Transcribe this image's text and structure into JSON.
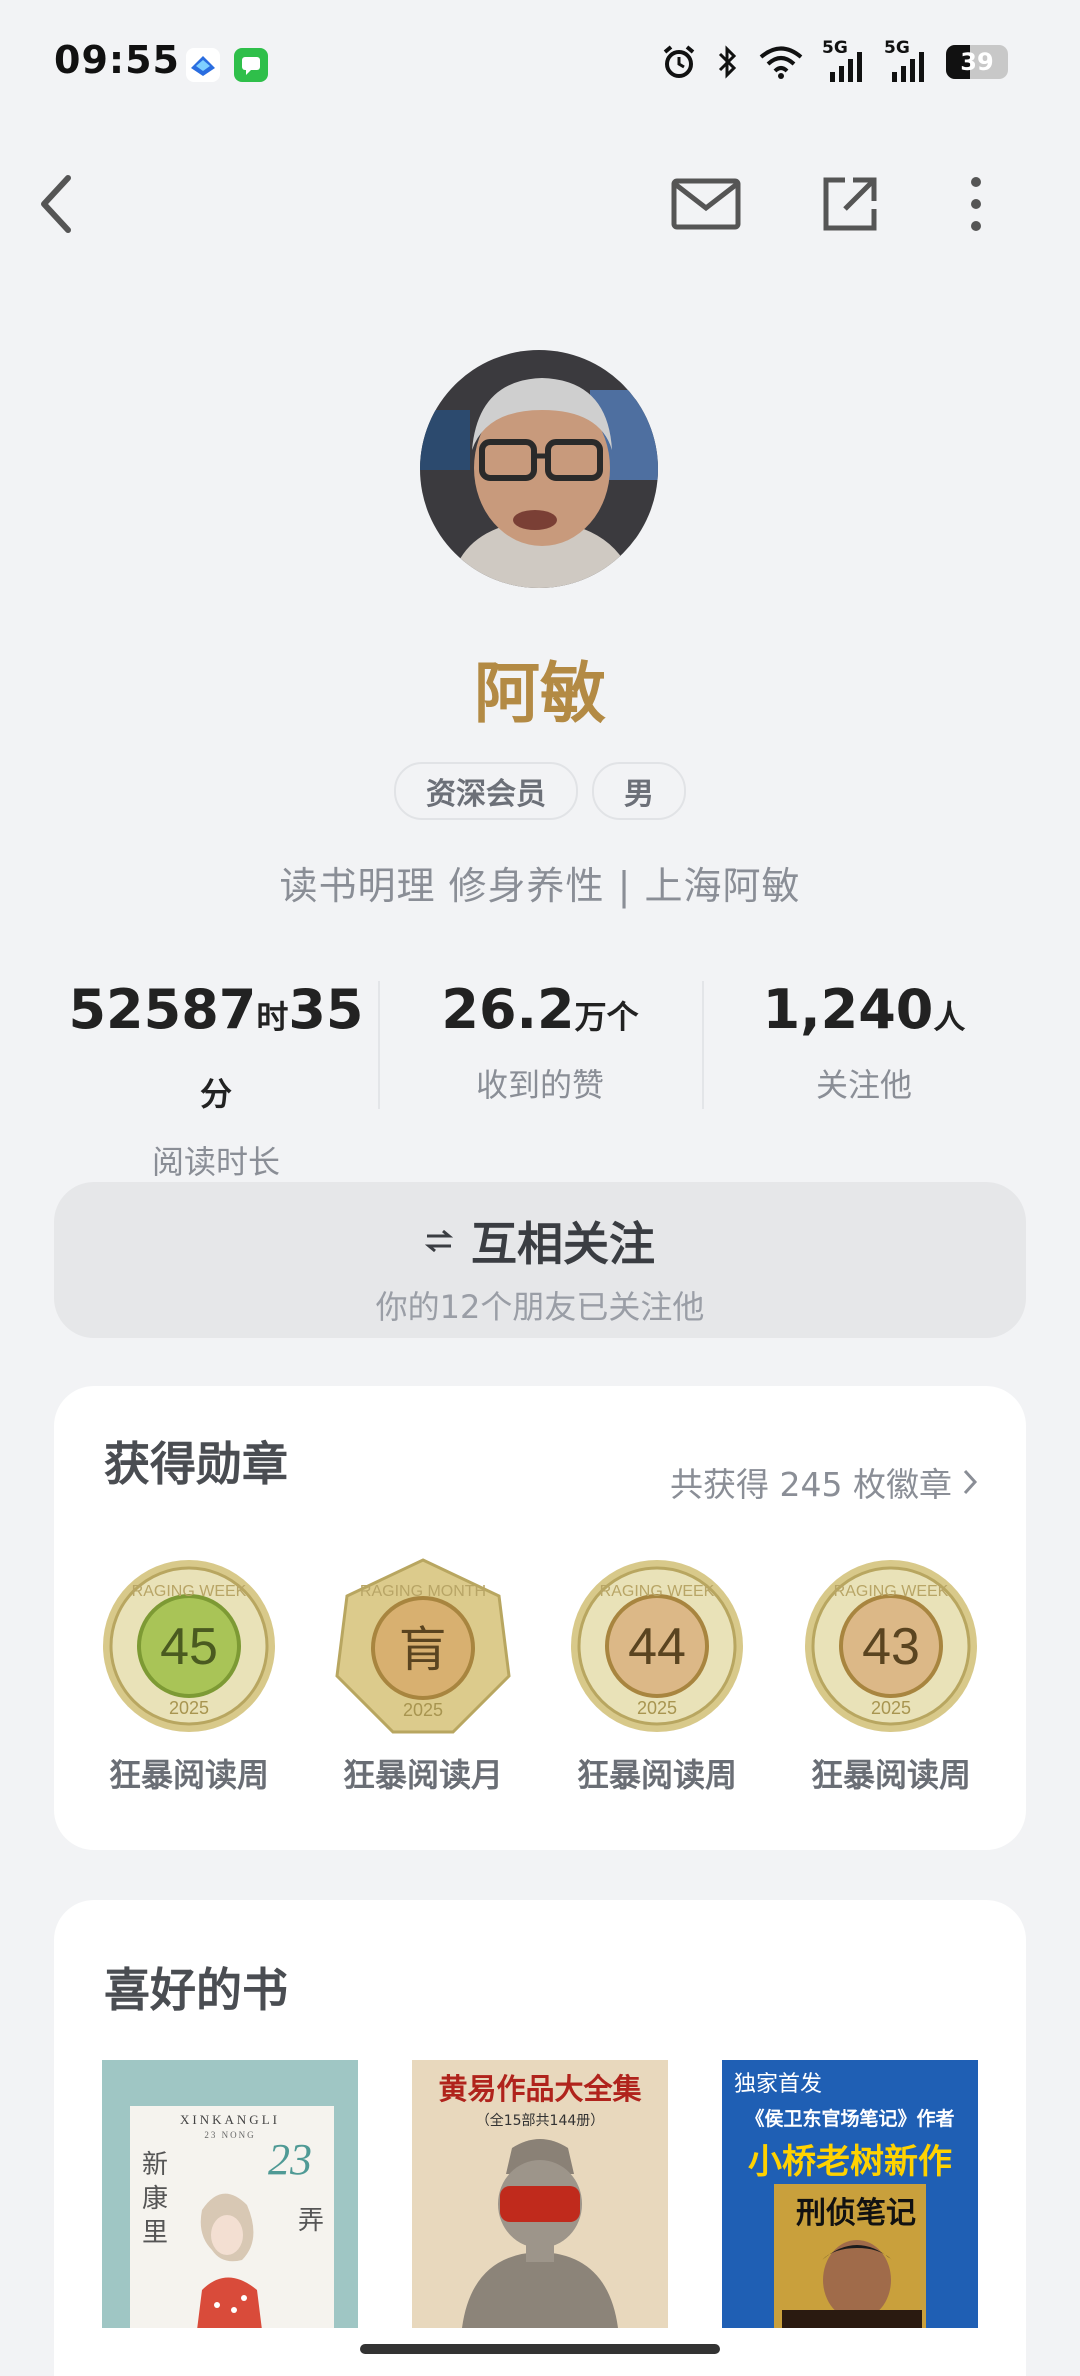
{
  "status_bar": {
    "time": "09:55",
    "network_1": "5G",
    "network_2": "5G",
    "battery": "39"
  },
  "header": {
    "back_icon": "chevron-left-icon",
    "message_icon": "mail-icon",
    "share_icon": "share-external-icon",
    "more_icon": "more-vertical-icon"
  },
  "profile": {
    "name": "阿敏",
    "tags": [
      "资深会员",
      "男"
    ],
    "bio": "读书明理 修身养性 | 上海阿敏"
  },
  "stats": {
    "reading_hours": "52587",
    "reading_hours_unit": "时",
    "reading_minutes": "35",
    "reading_minutes_unit": "分",
    "reading_label": "阅读时长",
    "likes_value": "26.2",
    "likes_unit": "万个",
    "likes_label": "收到的赞",
    "followers_value": "1,240",
    "followers_unit": "人",
    "followers_label": "关注他"
  },
  "follow": {
    "label": "互相关注",
    "subtitle": "你的12个朋友已关注他"
  },
  "medals": {
    "title": "获得勋章",
    "link": "共获得 245 枚徽章",
    "items": [
      {
        "label": "狂暴阅读周",
        "number": "45",
        "ring": "RAGING WEEK",
        "year": "2025"
      },
      {
        "label": "狂暴阅读月",
        "number": "肓",
        "ring": "RAGING MONTH",
        "year": "2025"
      },
      {
        "label": "狂暴阅读周",
        "number": "44",
        "ring": "RAGING WEEK",
        "year": "2025"
      },
      {
        "label": "狂暴阅读周",
        "number": "43",
        "ring": "RAGING WEEK",
        "year": "2025"
      }
    ]
  },
  "books": {
    "title": "喜好的书",
    "items": [
      {
        "cover_top": "XINKANGLI",
        "cover_sub": "23 NONG",
        "cover_left": "新康里",
        "cover_num": "23",
        "cover_right": "弄"
      },
      {
        "cover_title": "黄易作品大全集",
        "cover_sub": "（全15部共144册）"
      },
      {
        "cover_badge": "独家首发",
        "cover_line1": "《侯卫东官场笔记》作者",
        "cover_line2": "小桥老树新作",
        "cover_book": "刑侦笔记"
      }
    ]
  }
}
